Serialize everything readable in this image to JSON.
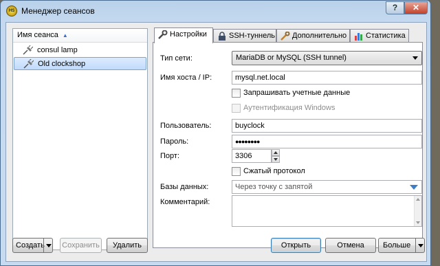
{
  "window": {
    "title": "Менеджер сеансов",
    "app_icon": "heidisql-icon",
    "help": "?",
    "close": "✕"
  },
  "sessions": {
    "header": "Имя сеанса",
    "sort_indicator": "▲",
    "items": [
      {
        "label": "consul lamp",
        "icon": "plug-icon",
        "selected": false
      },
      {
        "label": "Old clockshop",
        "icon": "plug-icon",
        "selected": true
      }
    ]
  },
  "left_buttons": {
    "create": "Создать",
    "save": "Сохранить",
    "delete": "Удалить"
  },
  "tabs": [
    {
      "label": "Настройки",
      "icon": "wrench-icon",
      "active": true
    },
    {
      "label": "SSH-туннель",
      "icon": "lock-icon",
      "active": false
    },
    {
      "label": "Дополнительно",
      "icon": "tools-icon",
      "active": false
    },
    {
      "label": "Статистика",
      "icon": "bar-chart-icon",
      "active": false
    }
  ],
  "settings": {
    "network_type_label": "Тип сети:",
    "network_type_value": "MariaDB or MySQL (SSH tunnel)",
    "host_label": "Имя хоста / IP:",
    "host_value": "mysql.net.local",
    "prompt_credentials": "Запрашивать учетные данные",
    "windows_auth": "Аутентификация Windows",
    "user_label": "Пользователь:",
    "user_value": "buyclock",
    "password_label": "Пароль:",
    "password_value": "●●●●●●●●",
    "port_label": "Порт:",
    "port_value": "3306",
    "compressed": "Сжатый протокол",
    "databases_label": "Базы данных:",
    "databases_placeholder": "Через точку с запятой",
    "comment_label": "Комментарий:",
    "comment_value": ""
  },
  "bottom_buttons": {
    "open": "Открыть",
    "cancel": "Отмена",
    "more": "Больше"
  },
  "colors": {
    "accent": "#3c7fb1",
    "selection": "#c1dbfc"
  }
}
